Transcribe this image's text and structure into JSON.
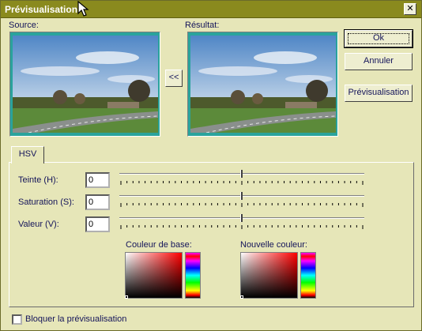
{
  "window": {
    "title": "Prévisualisation",
    "close_glyph": "✕"
  },
  "source": {
    "label": "Source:"
  },
  "result": {
    "label": "Résultat:"
  },
  "copy_button_label": "<<",
  "buttons": {
    "ok": "Ok",
    "cancel": "Annuler",
    "preview": "Prévisualisation"
  },
  "tabs": [
    {
      "label": "HSV",
      "selected": true
    }
  ],
  "hsv": {
    "hue": {
      "label": "Teinte (H):",
      "value": "0",
      "level": 0.5
    },
    "saturation": {
      "label": "Saturation (S):",
      "value": "0",
      "level": 0.5
    },
    "value": {
      "label": "Valeur (V):",
      "value": "0",
      "level": 0.5
    }
  },
  "colors": {
    "base_label": "Couleur de base:",
    "new_label": "Nouvelle couleur:",
    "base_color": "#ff0000",
    "new_color": "#ff0000"
  },
  "lock_preview": {
    "label": "Bloquer la prévisualisation",
    "checked": false
  },
  "theme": {
    "titlebar": "#8a8a1e",
    "background": "#e6e6b8",
    "frame_accent": "#2aa39c"
  },
  "icons": {
    "cursor": "arrow-cursor-icon",
    "close": "close-icon"
  }
}
